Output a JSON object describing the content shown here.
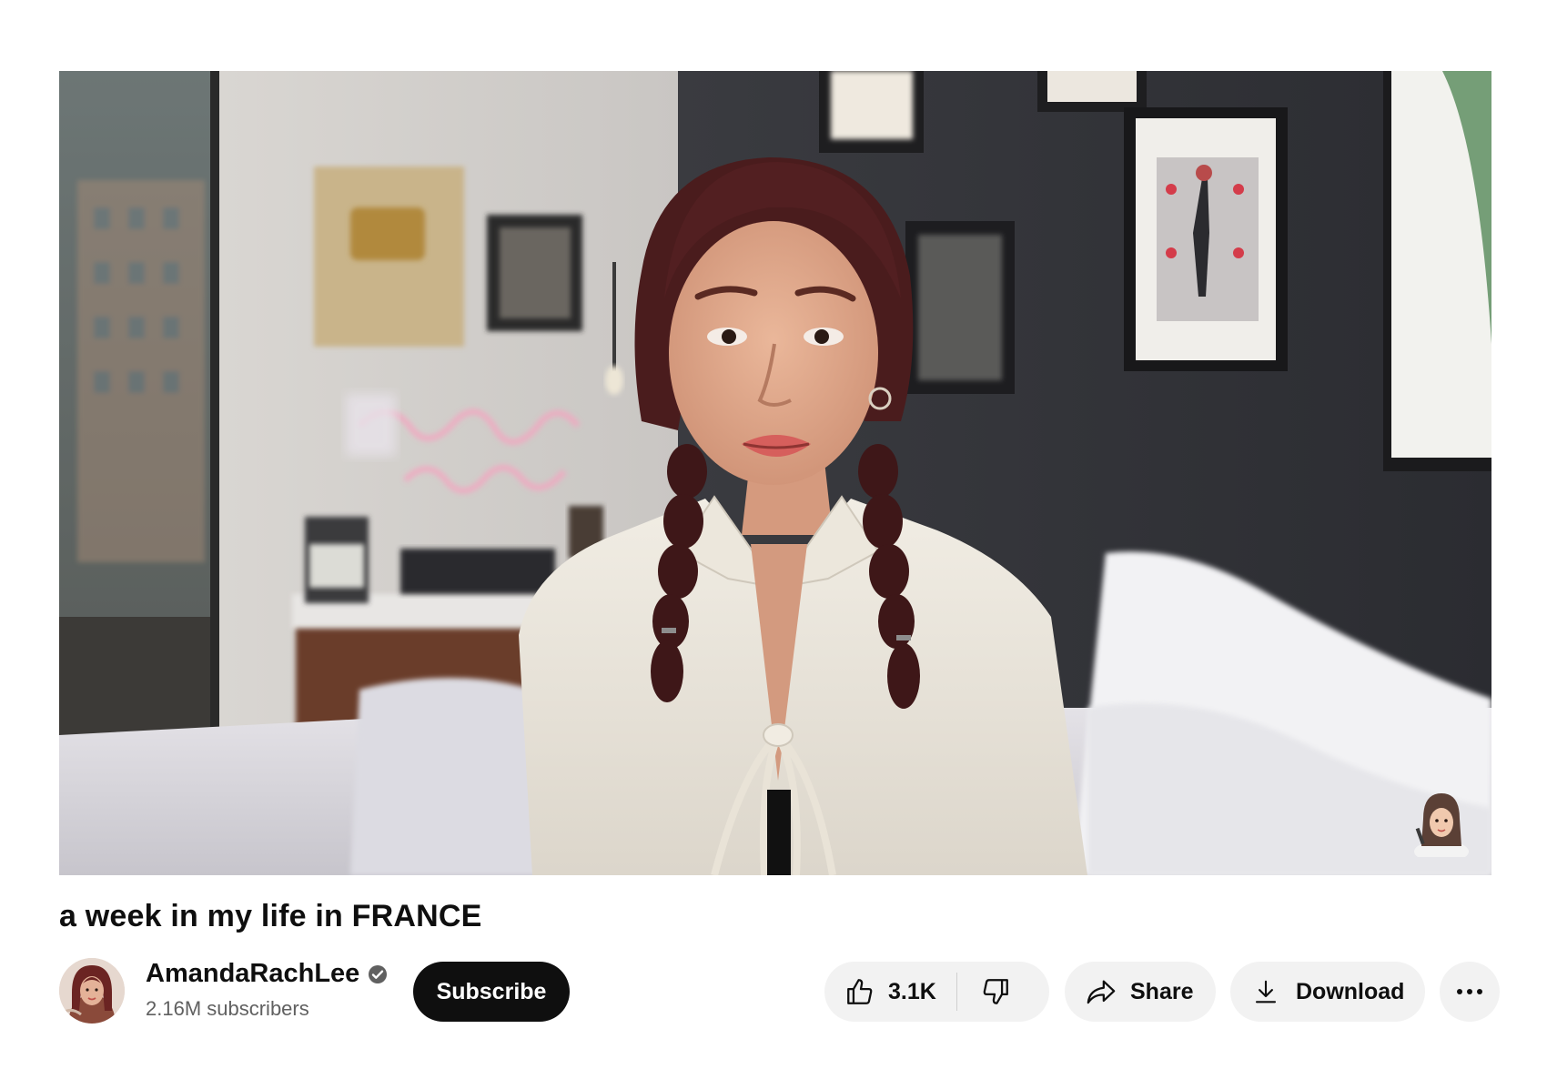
{
  "video": {
    "title": "a week in my life in FRANCE"
  },
  "channel": {
    "name": "AmandaRachLee",
    "subscribers": "2.16M subscribers",
    "verified": true
  },
  "actions": {
    "subscribe_label": "Subscribe",
    "like_count": "3.1K",
    "share_label": "Share",
    "download_label": "Download"
  },
  "icons": {
    "verified": "verified-check-icon",
    "like": "thumbs-up-icon",
    "dislike": "thumbs-down-icon",
    "share": "share-arrow-icon",
    "download": "download-icon",
    "more": "more-horizontal-icon"
  },
  "colors": {
    "subscribe_bg": "#0f0f0f",
    "pill_bg": "#f2f2f2",
    "secondary_text": "#606060"
  }
}
